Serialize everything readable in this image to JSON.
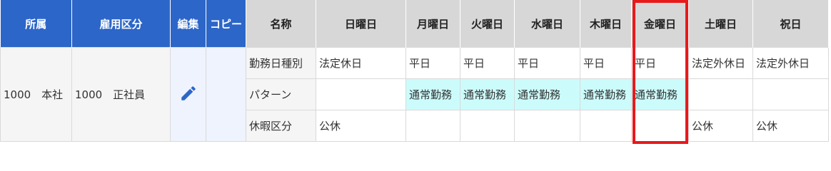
{
  "header": {
    "shozoku": "所属",
    "koyou": "雇用区分",
    "edit": "編集",
    "copy": "コピー",
    "name": "名称",
    "days": [
      "日曜日",
      "月曜日",
      "火曜日",
      "水曜日",
      "木曜日",
      "金曜日",
      "土曜日",
      "祝日"
    ]
  },
  "row": {
    "shozoku": "1000　本社",
    "koyou": "1000　正社員",
    "labels": [
      "勤務日種別",
      "パターン",
      "休暇区分"
    ],
    "kinmubi": [
      "法定休日",
      "平日",
      "平日",
      "平日",
      "平日",
      "平日",
      "法定外休日",
      "法定外休日"
    ],
    "pattern": [
      "",
      "通常勤務",
      "通常勤務",
      "通常勤務",
      "通常勤務",
      "通常勤務",
      "",
      ""
    ],
    "kyuka": [
      "公休",
      "",
      "",
      "",
      "",
      "",
      "公休",
      "公休"
    ]
  },
  "colors": {
    "header_blue": "#2c66c8",
    "header_gray": "#d7d7d7",
    "cyan_cell": "#ccfbfb",
    "highlight_red": "#e8191b",
    "pencil_blue": "#2c66c8"
  },
  "icons": {
    "edit": "pencil-icon"
  }
}
